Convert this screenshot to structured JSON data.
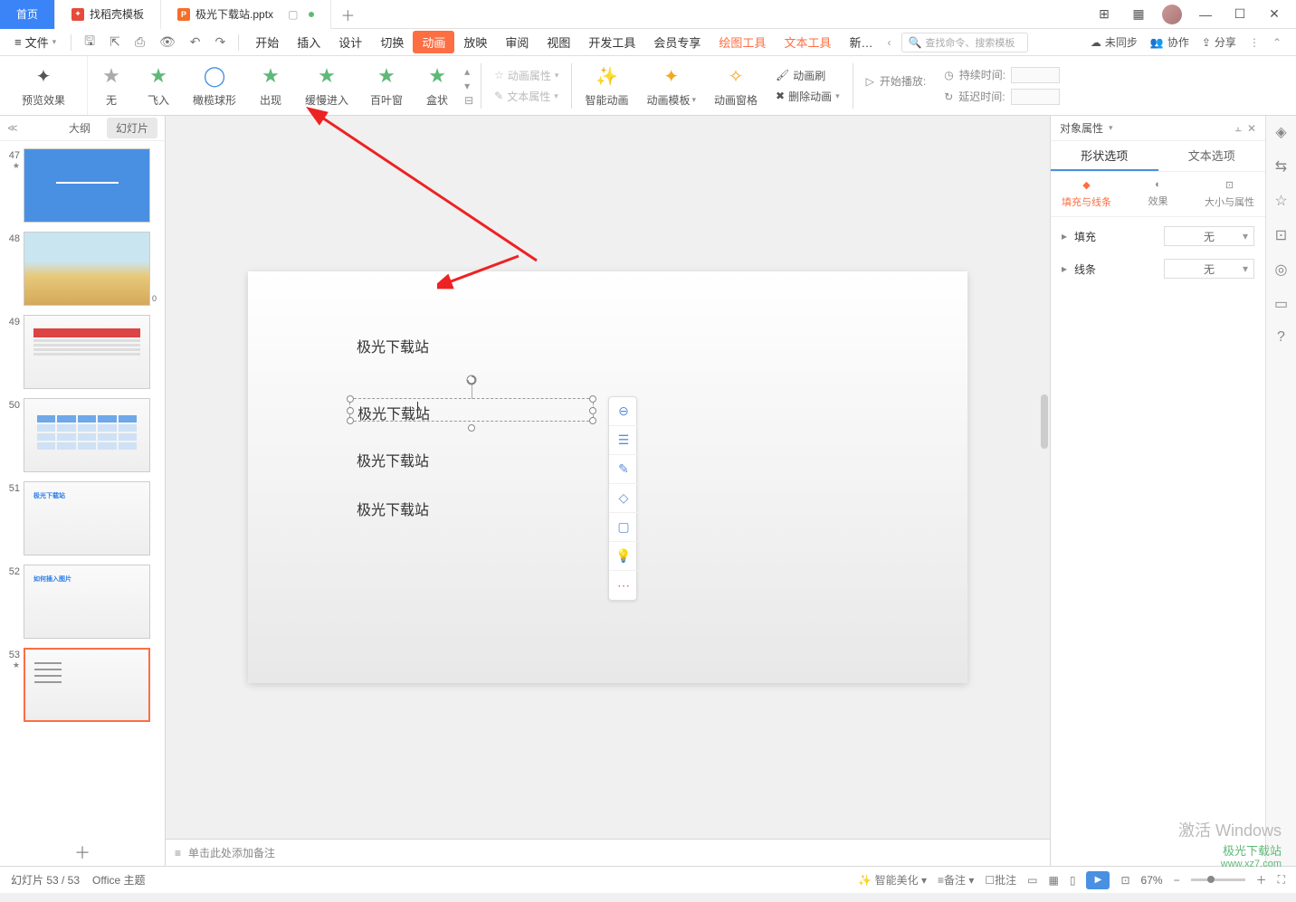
{
  "titlebar": {
    "home": "首页",
    "template": "找稻壳模板",
    "filename": "极光下载站.pptx"
  },
  "window": {
    "layout_icon": "⊞",
    "grid_icon": "▦"
  },
  "menubar": {
    "file": "文件",
    "items": [
      "开始",
      "插入",
      "设计",
      "切换",
      "动画",
      "放映",
      "审阅",
      "视图",
      "开发工具",
      "会员专享",
      "绘图工具",
      "文本工具",
      "新…"
    ],
    "active_index": 4,
    "tool_indices": [
      10,
      11
    ],
    "search_placeholder": "查找命令、搜索模板",
    "right": {
      "unsync": "未同步",
      "collab": "协作",
      "share": "分享"
    }
  },
  "ribbon": {
    "preview": "预览效果",
    "effects": [
      {
        "label": "无",
        "type": "gray"
      },
      {
        "label": "飞入",
        "type": "green"
      },
      {
        "label": "橄榄球形",
        "type": "blue-ring"
      },
      {
        "label": "出现",
        "type": "green"
      },
      {
        "label": "缓慢进入",
        "type": "green"
      },
      {
        "label": "百叶窗",
        "type": "green"
      },
      {
        "label": "盒状",
        "type": "green"
      }
    ],
    "anim_prop": "动画属性",
    "text_prop": "文本属性",
    "smart_anim": "智能动画",
    "anim_template": "动画模板",
    "anim_pane": "动画窗格",
    "anim_brush": "动画刷",
    "delete_anim": "删除动画",
    "start_play": "开始播放:",
    "duration": "持续时间:",
    "delay": "延迟时间:"
  },
  "slidepanel": {
    "outline": "大纲",
    "slides": "幻灯片",
    "thumbs": [
      {
        "num": "47",
        "star": true,
        "type": "blue"
      },
      {
        "num": "48",
        "star": false,
        "type": "img",
        "badge": "0"
      },
      {
        "num": "49",
        "star": false,
        "type": "table"
      },
      {
        "num": "50",
        "star": false,
        "type": "grid"
      },
      {
        "num": "51",
        "star": false,
        "type": "title",
        "title": "极光下载站"
      },
      {
        "num": "52",
        "star": false,
        "type": "title",
        "title": "如何插入图片"
      },
      {
        "num": "53",
        "star": true,
        "type": "textslide",
        "selected": true
      }
    ]
  },
  "canvas": {
    "lines": [
      "极光下载站",
      "极光下载站",
      "极光下载站",
      "极光下载站"
    ],
    "notes_placeholder": "单击此处添加备注"
  },
  "props": {
    "title": "对象属性",
    "tab_shape": "形状选项",
    "tab_text": "文本选项",
    "sub_fill": "填充与线条",
    "sub_effect": "效果",
    "sub_size": "大小与属性",
    "fill_label": "填充",
    "line_label": "线条",
    "none_value": "无"
  },
  "statusbar": {
    "slide_info": "幻灯片 53 / 53",
    "theme": "Office 主题",
    "beautify": "智能美化",
    "notes": "备注",
    "comments": "批注",
    "zoom": "67%"
  },
  "watermark": {
    "l1": "激活 Windows",
    "l2": "极光下载站",
    "l3": "www.xz7.com"
  }
}
